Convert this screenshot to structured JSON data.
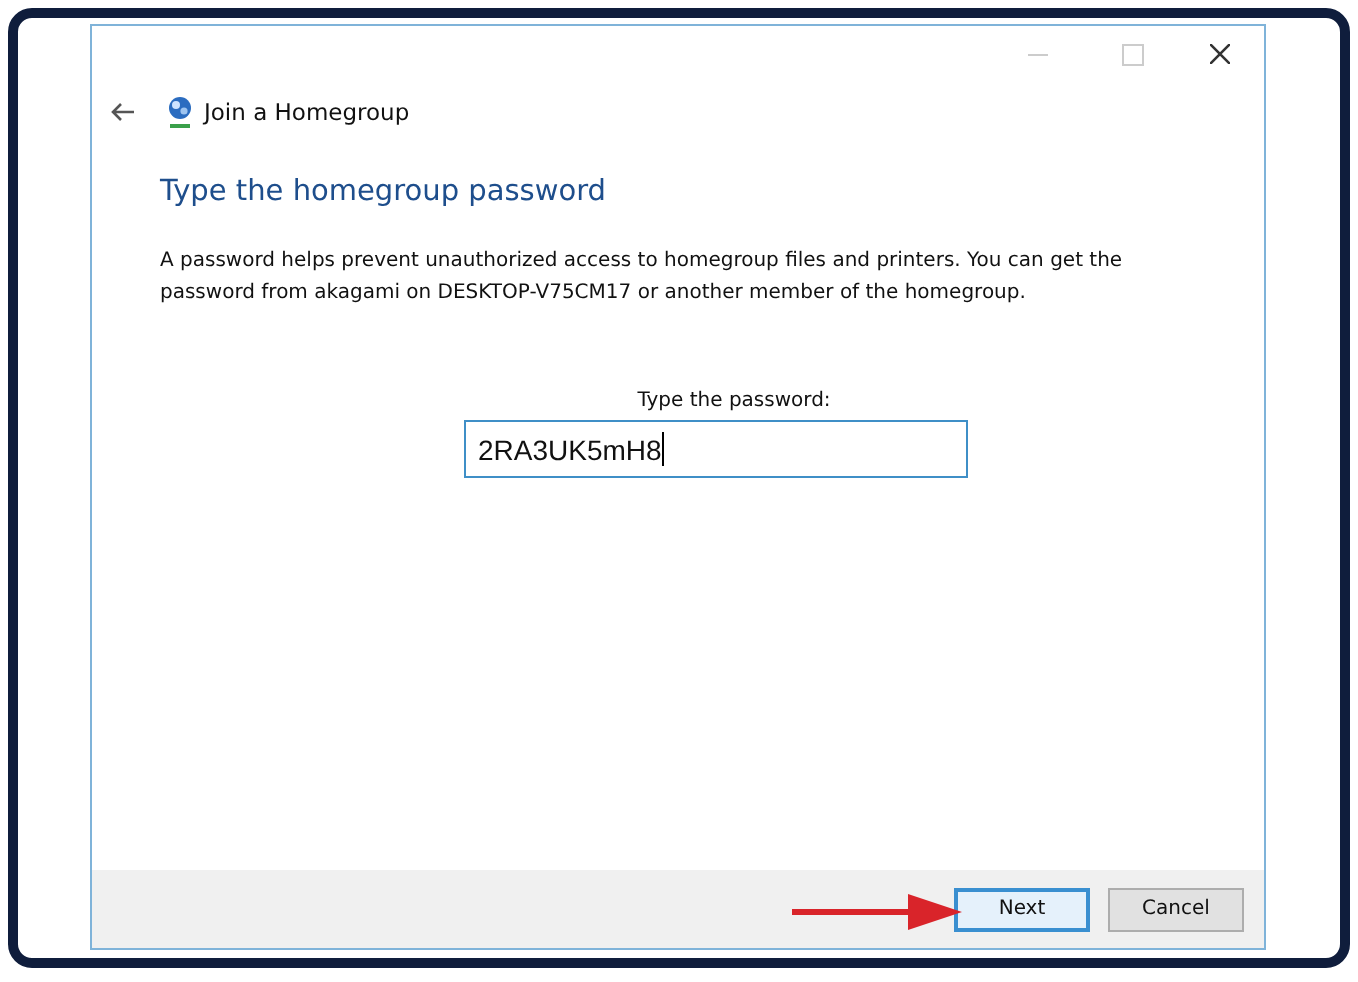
{
  "window": {
    "title": "Join a Homegroup",
    "maximize_disabled": true
  },
  "heading": "Type the homegroup password",
  "description": "A password helps prevent unauthorized access to homegroup files and printers. You can get the password from akagami on DESKTOP-V75CM17 or another member of the homegroup.",
  "password": {
    "label": "Type the password:",
    "value": "2RA3UK5mH8"
  },
  "buttons": [
    {
      "label": "Next",
      "default": true
    },
    {
      "label": "Cancel",
      "default": false
    }
  ]
}
